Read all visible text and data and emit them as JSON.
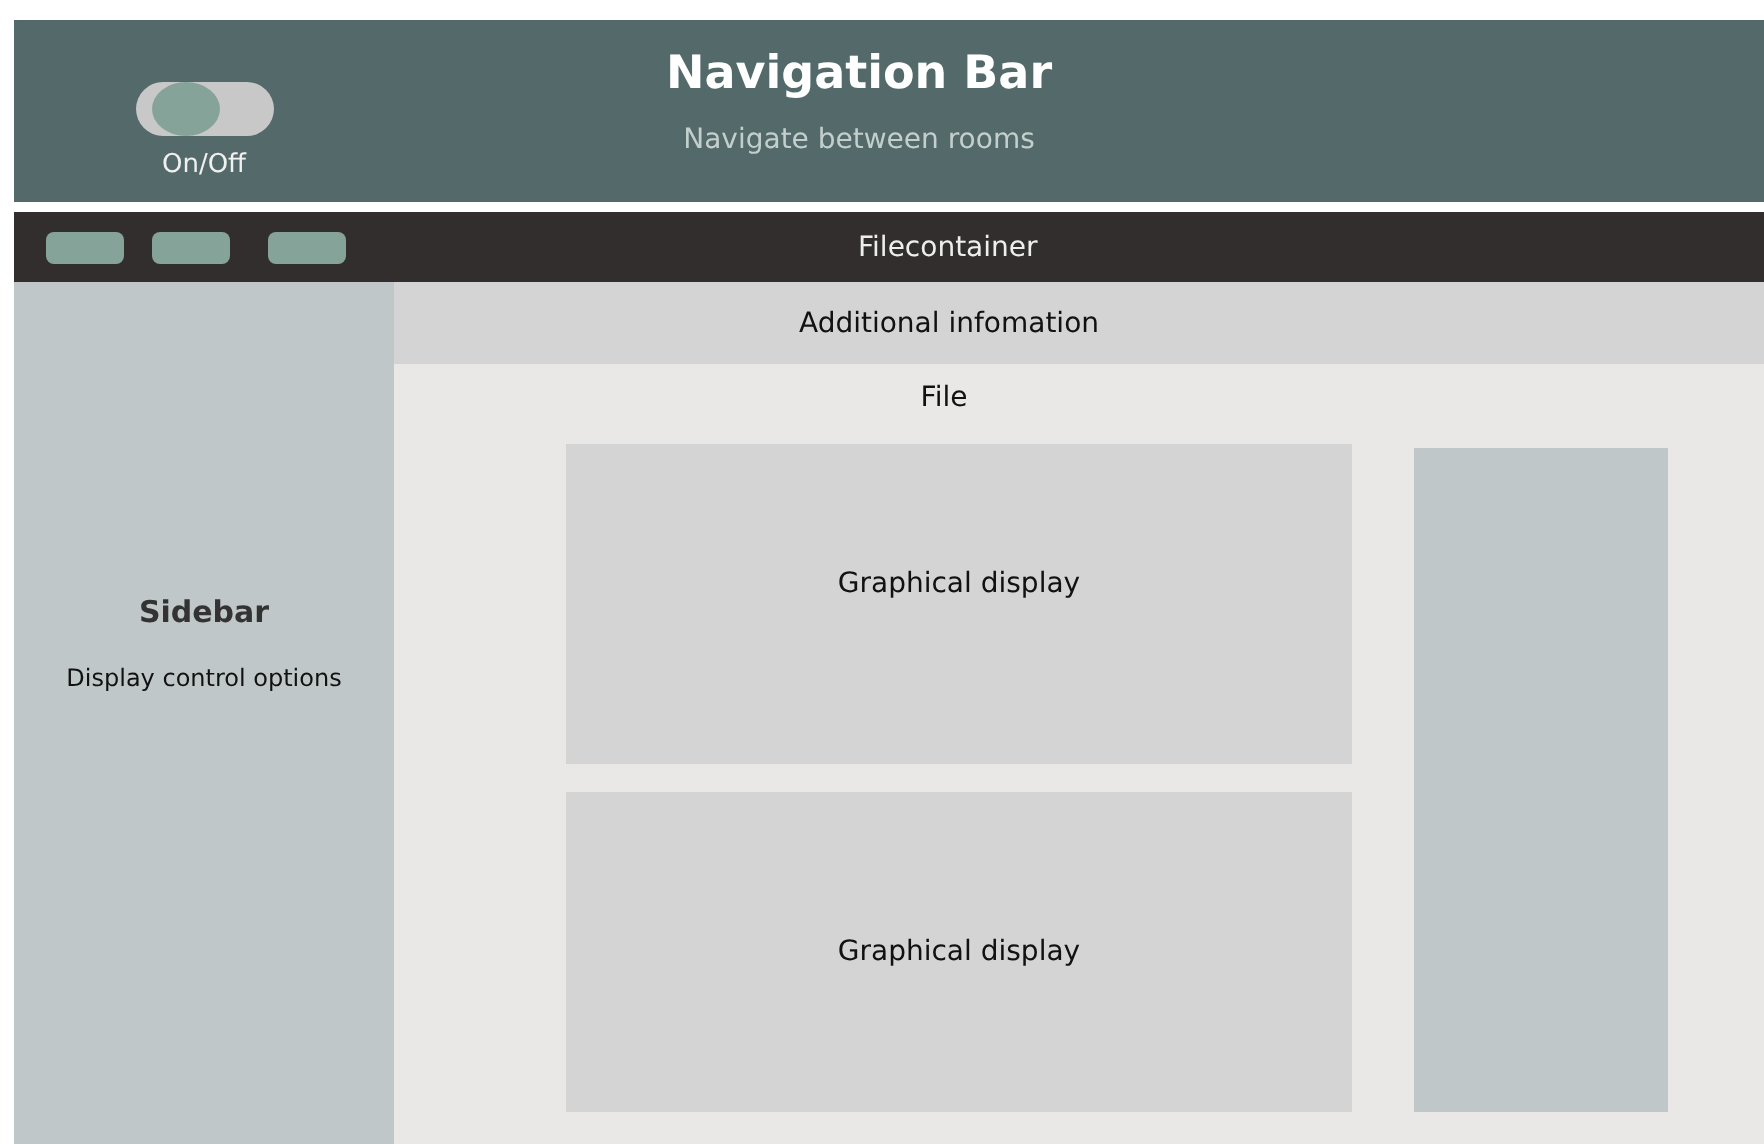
{
  "navigation_bar": {
    "title": "Navigation Bar",
    "subtitle": "Navigate between rooms",
    "toggle": {
      "label": "On/Off",
      "on": false
    }
  },
  "file_container": {
    "title": "Filecontainer"
  },
  "sidebar": {
    "title": "Sidebar",
    "text": "Display control options"
  },
  "info_bar": {
    "title": "Additional infomation"
  },
  "file": {
    "title": "File",
    "displays": [
      "Graphical display",
      "Graphical display"
    ]
  }
}
